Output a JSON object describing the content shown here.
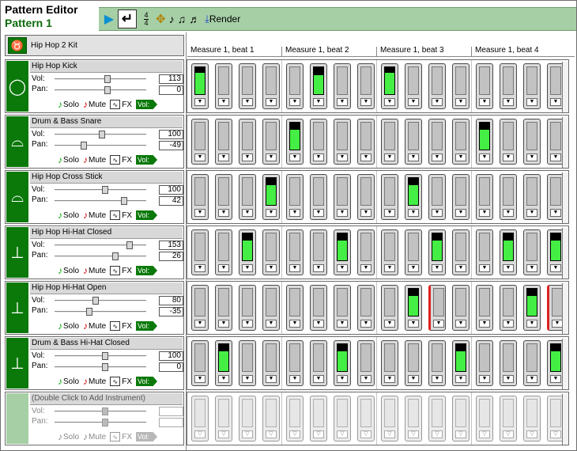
{
  "header": {
    "title": "Pattern Editor",
    "pattern_name": "Pattern 1"
  },
  "toolbar": {
    "play_icon": "▶",
    "loop_icon": "↵",
    "time_sig_top": "4",
    "time_sig_bottom": "4",
    "tool_icons": [
      "♪",
      "♫",
      "♬"
    ],
    "render_label": "Render"
  },
  "kit": {
    "label": "Hip Hop 2 Kit",
    "icon": "♉"
  },
  "measures": [
    "Measure 1, beat 1",
    "Measure 1, beat 2",
    "Measure 1, beat 3",
    "Measure 1, beat 4"
  ],
  "labels": {
    "vol": "Vol:",
    "pan": "Pan:",
    "solo": "Solo",
    "mute": "Mute",
    "fx": "FX",
    "vol_button": "Vol:"
  },
  "colors": {
    "accent_green": "#0a790a",
    "band": "#a6cfa6",
    "step_fill": "#44ee44"
  },
  "tracks": [
    {
      "name": "Hip Hop Kick",
      "icon": "◯",
      "vol": "113",
      "pan": "0",
      "vol_level": 0.58,
      "pan_level": 0.58,
      "steps": [
        0.8,
        0,
        0,
        0,
        0,
        0.7,
        0,
        0,
        0.8,
        0,
        0,
        0,
        0,
        0,
        0,
        0
      ],
      "accent": []
    },
    {
      "name": "Drum & Bass Snare",
      "icon": "⌓",
      "vol": "100",
      "pan": "-49",
      "vol_level": 0.52,
      "pan_level": 0.32,
      "steps": [
        0,
        0,
        0,
        0,
        0.75,
        0,
        0,
        0,
        0,
        0,
        0,
        0,
        0.75,
        0,
        0,
        0
      ],
      "accent": []
    },
    {
      "name": "Hip Hop Cross Stick",
      "icon": "⌓",
      "vol": "100",
      "pan": "42",
      "vol_level": 0.55,
      "pan_level": 0.76,
      "steps": [
        0,
        0,
        0,
        0.75,
        0,
        0,
        0,
        0,
        0,
        0.75,
        0,
        0,
        0,
        0,
        0,
        0
      ],
      "accent": []
    },
    {
      "name": "Hip Hop Hi-Hat Closed",
      "icon": "⊥",
      "vol": "153",
      "pan": "26",
      "vol_level": 0.82,
      "pan_level": 0.66,
      "steps": [
        0,
        0,
        0.75,
        0,
        0,
        0,
        0.75,
        0,
        0,
        0,
        0.75,
        0,
        0,
        0.75,
        0,
        0.75
      ],
      "accent": []
    },
    {
      "name": "Hip Hop Hi-Hat Open",
      "icon": "⊥",
      "vol": "80",
      "pan": "-35",
      "vol_level": 0.45,
      "pan_level": 0.38,
      "steps": [
        0,
        0,
        0,
        0,
        0,
        0,
        0,
        0,
        0,
        0.75,
        0.0,
        0,
        0,
        0,
        0.75,
        0.0
      ],
      "accent": [
        10,
        15
      ]
    },
    {
      "name": "Drum & Bass Hi-Hat Closed",
      "icon": "⊥",
      "vol": "100",
      "pan": "0",
      "vol_level": 0.55,
      "pan_level": 0.55,
      "steps": [
        0,
        0.75,
        0,
        0,
        0,
        0,
        0.75,
        0,
        0,
        0,
        0,
        0.75,
        0,
        0,
        0,
        0.75
      ],
      "accent": []
    }
  ],
  "empty_track": {
    "name": "(Double Click to Add Instrument)"
  }
}
